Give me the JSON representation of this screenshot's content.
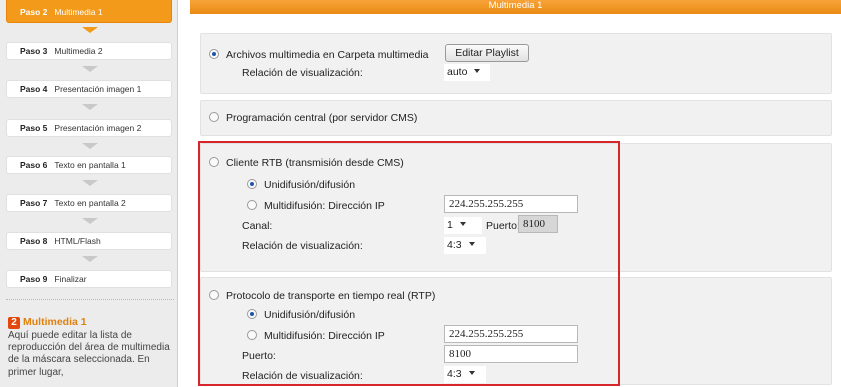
{
  "sidebar": {
    "steps": [
      {
        "num": "Paso 2",
        "label": "Multimedia 1"
      },
      {
        "num": "Paso 3",
        "label": "Multimedia 2"
      },
      {
        "num": "Paso 4",
        "label": "Presentación imagen 1"
      },
      {
        "num": "Paso 5",
        "label": "Presentación imagen 2"
      },
      {
        "num": "Paso 6",
        "label": "Texto en pantalla 1"
      },
      {
        "num": "Paso 7",
        "label": "Texto en pantalla 2"
      },
      {
        "num": "Paso 8",
        "label": "HTML/Flash"
      },
      {
        "num": "Paso 9",
        "label": "Finalizar"
      }
    ],
    "help": {
      "badge": "2",
      "title": "Multimedia 1",
      "text": "Aquí puede editar la lista de reproducción del área de multimedia de la máscara seleccionada. En primer lugar,"
    }
  },
  "main": {
    "header_title": "Multimedia 1",
    "carpeta": {
      "label": "Archivos multimedia en Carpeta multimedia",
      "edit_button": "Editar Playlist",
      "ratio_label": "Relación de visualización:",
      "ratio_value": "auto"
    },
    "cms": {
      "label": "Programación central (por servidor CMS)"
    },
    "rtb": {
      "label": "Cliente RTB (transmisión desde CMS)",
      "unicast_label": "Unidifusión/difusión",
      "multicast_label": "Multidifusión: Dirección IP",
      "ip_value": "224.255.255.255",
      "channel_label": "Canal:",
      "channel_value": "1",
      "port_label": "Puerto:",
      "port_value": "8100",
      "ratio_label": "Relación de visualización:",
      "ratio_value": "4:3"
    },
    "rtp": {
      "label": "Protocolo de transporte en tiempo real (RTP)",
      "unicast_label": "Unidifusión/difusión",
      "multicast_label": "Multidifusión: Dirección IP",
      "ip_value": "224.255.255.255",
      "port_label": "Puerto:",
      "port_value": "8100",
      "ratio_label": "Relación de visualización:",
      "ratio_value": "4:3"
    }
  },
  "colors": {
    "accent_orange": "#f39a1b",
    "highlight_red": "#d6252b",
    "radio_blue": "#1f55a8"
  }
}
